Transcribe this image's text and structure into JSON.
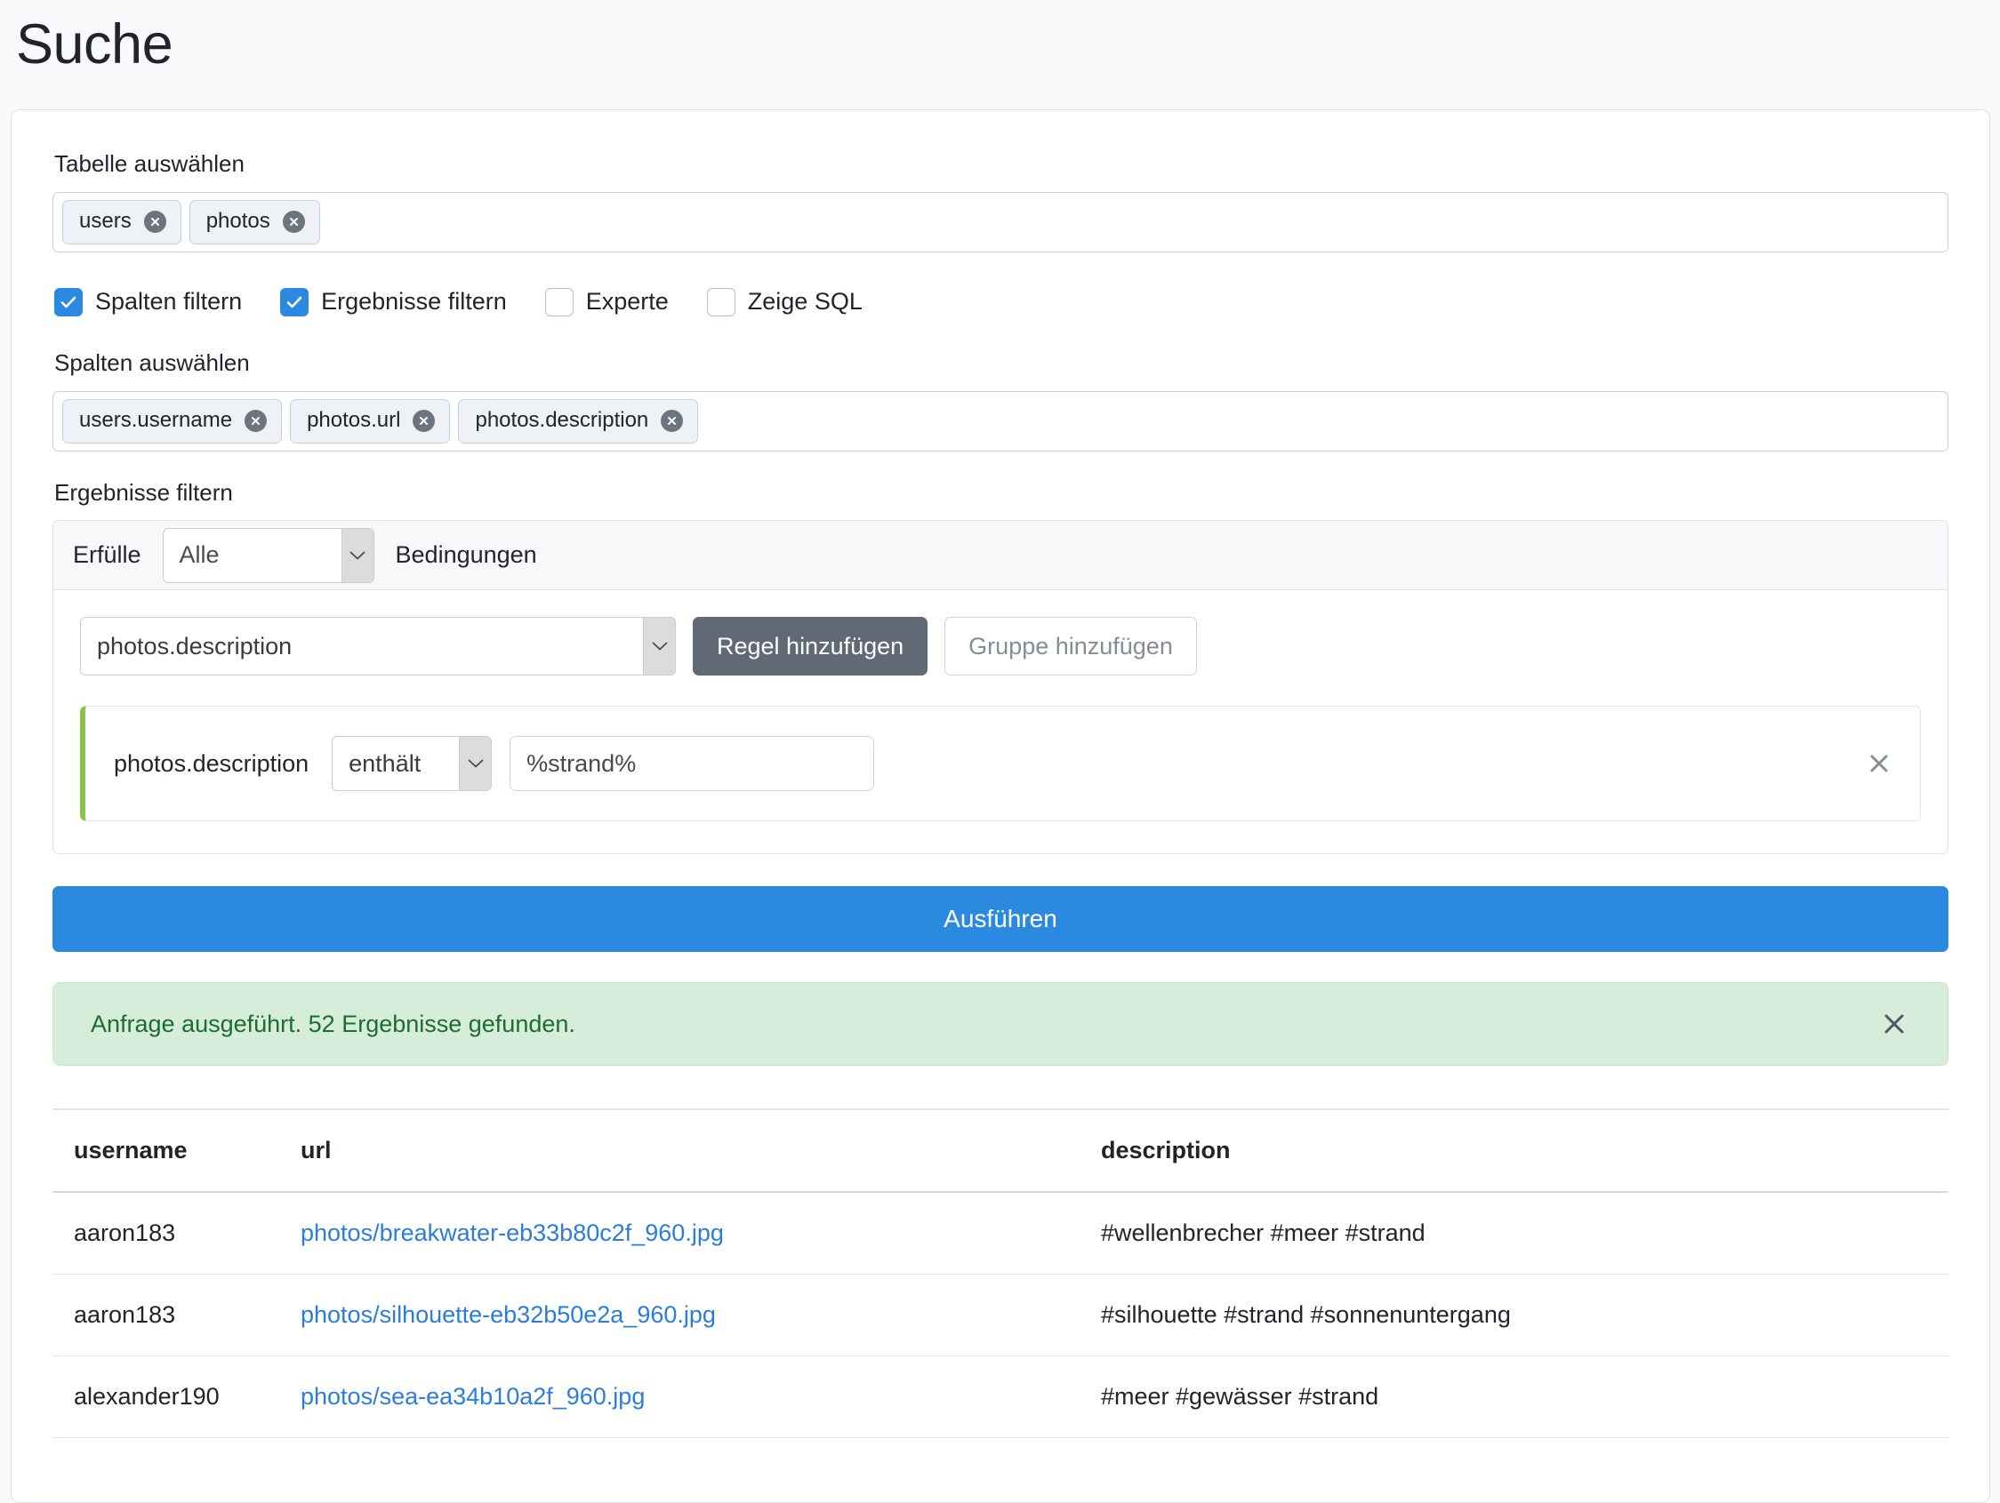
{
  "page": {
    "title": "Suche"
  },
  "tables": {
    "label": "Tabelle auswählen",
    "tags": [
      "users",
      "photos"
    ]
  },
  "options": [
    {
      "label": "Spalten filtern",
      "checked": true,
      "name": "spalten-filtern"
    },
    {
      "label": "Ergebnisse filtern",
      "checked": true,
      "name": "ergebnisse-filtern"
    },
    {
      "label": "Experte",
      "checked": false,
      "name": "experte"
    },
    {
      "label": "Zeige SQL",
      "checked": false,
      "name": "zeige-sql"
    }
  ],
  "columns": {
    "label": "Spalten auswählen",
    "tags": [
      "users.username",
      "photos.url",
      "photos.description"
    ]
  },
  "filters": {
    "label": "Ergebnisse filtern",
    "header": {
      "prefix": "Erfülle",
      "match_value": "Alle",
      "suffix": "Bedingungen"
    },
    "field_select_value": "photos.description",
    "add_rule_label": "Regel hinzufügen",
    "add_group_label": "Gruppe hinzufügen",
    "rules": [
      {
        "field": "photos.description",
        "operator": "enthält",
        "value": "%strand%"
      }
    ]
  },
  "run_button_label": "Ausführen",
  "alert": {
    "message": "Anfrage ausgeführt. 52 Ergebnisse gefunden.",
    "color": "#1d6b35",
    "background": "#d6edda"
  },
  "results": {
    "headers": [
      "username",
      "url",
      "description"
    ],
    "rows": [
      {
        "username": "aaron183",
        "url": "photos/breakwater-eb33b80c2f_960.jpg",
        "description": "#wellenbrecher #meer #strand"
      },
      {
        "username": "aaron183",
        "url": "photos/silhouette-eb32b50e2a_960.jpg",
        "description": "#silhouette #strand #sonnenuntergang"
      },
      {
        "username": "alexander190",
        "url": "photos/sea-ea34b10a2f_960.jpg",
        "description": "#meer #gewässer #strand"
      }
    ]
  },
  "accent": {
    "primary": "#2b8ae0",
    "rule_border": "#8bc34a",
    "secondary_button": "#5f6a74"
  }
}
